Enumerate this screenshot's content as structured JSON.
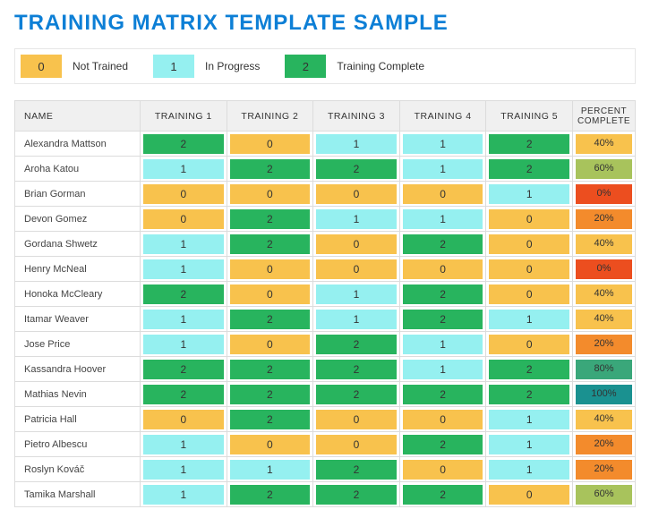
{
  "title": "TRAINING MATRIX TEMPLATE SAMPLE",
  "legend": [
    {
      "code": "0",
      "label": "Not Trained",
      "swatch": "c-orange"
    },
    {
      "code": "1",
      "label": "In Progress",
      "swatch": "c-cyan"
    },
    {
      "code": "2",
      "label": "Training Complete",
      "swatch": "c-green"
    }
  ],
  "columns": {
    "name": "NAME",
    "trainings": [
      "TRAINING 1",
      "TRAINING 2",
      "TRAINING 3",
      "TRAINING 4",
      "TRAINING 5"
    ],
    "percent": "PERCENT COMPLETE"
  },
  "rows": [
    {
      "name": "Alexandra Mattson",
      "v": [
        2,
        0,
        1,
        1,
        2
      ],
      "pct": "40%"
    },
    {
      "name": "Aroha Katou",
      "v": [
        1,
        2,
        2,
        1,
        2
      ],
      "pct": "60%"
    },
    {
      "name": "Brian Gorman",
      "v": [
        0,
        0,
        0,
        0,
        1
      ],
      "pct": "0%"
    },
    {
      "name": "Devon Gomez",
      "v": [
        0,
        2,
        1,
        1,
        0
      ],
      "pct": "20%"
    },
    {
      "name": "Gordana Shwetz",
      "v": [
        1,
        2,
        0,
        2,
        0
      ],
      "pct": "40%"
    },
    {
      "name": "Henry McNeal",
      "v": [
        1,
        0,
        0,
        0,
        0
      ],
      "pct": "0%"
    },
    {
      "name": "Honoka McCleary",
      "v": [
        2,
        0,
        1,
        2,
        0
      ],
      "pct": "40%"
    },
    {
      "name": "Itamar Weaver",
      "v": [
        1,
        2,
        1,
        2,
        1
      ],
      "pct": "40%"
    },
    {
      "name": "Jose Price",
      "v": [
        1,
        0,
        2,
        1,
        0
      ],
      "pct": "20%"
    },
    {
      "name": "Kassandra Hoover",
      "v": [
        2,
        2,
        2,
        1,
        2
      ],
      "pct": "80%"
    },
    {
      "name": "Mathias Nevin",
      "v": [
        2,
        2,
        2,
        2,
        2
      ],
      "pct": "100%"
    },
    {
      "name": "Patricia Hall",
      "v": [
        0,
        2,
        0,
        0,
        1
      ],
      "pct": "40%"
    },
    {
      "name": "Pietro Albescu",
      "v": [
        1,
        0,
        0,
        2,
        1
      ],
      "pct": "20%"
    },
    {
      "name": "Roslyn Kováč",
      "v": [
        1,
        1,
        2,
        0,
        1
      ],
      "pct": "20%"
    },
    {
      "name": "Tamika Marshall",
      "v": [
        1,
        2,
        2,
        2,
        0
      ],
      "pct": "60%"
    }
  ],
  "chart_data": {
    "type": "table",
    "title": "Training Matrix",
    "value_meaning": {
      "0": "Not Trained",
      "1": "In Progress",
      "2": "Training Complete"
    },
    "columns": [
      "TRAINING 1",
      "TRAINING 2",
      "TRAINING 3",
      "TRAINING 4",
      "TRAINING 5"
    ],
    "names": [
      "Alexandra Mattson",
      "Aroha Katou",
      "Brian Gorman",
      "Devon Gomez",
      "Gordana Shwetz",
      "Henry McNeal",
      "Honoka McCleary",
      "Itamar Weaver",
      "Jose Price",
      "Kassandra Hoover",
      "Mathias Nevin",
      "Patricia Hall",
      "Pietro Albescu",
      "Roslyn Kováč",
      "Tamika Marshall"
    ],
    "matrix": [
      [
        2,
        0,
        1,
        1,
        2
      ],
      [
        1,
        2,
        2,
        1,
        2
      ],
      [
        0,
        0,
        0,
        0,
        1
      ],
      [
        0,
        2,
        1,
        1,
        0
      ],
      [
        1,
        2,
        0,
        2,
        0
      ],
      [
        1,
        0,
        0,
        0,
        0
      ],
      [
        2,
        0,
        1,
        2,
        0
      ],
      [
        1,
        2,
        1,
        2,
        1
      ],
      [
        1,
        0,
        2,
        1,
        0
      ],
      [
        2,
        2,
        2,
        1,
        2
      ],
      [
        2,
        2,
        2,
        2,
        2
      ],
      [
        0,
        2,
        0,
        0,
        1
      ],
      [
        1,
        0,
        0,
        2,
        1
      ],
      [
        1,
        1,
        2,
        0,
        1
      ],
      [
        1,
        2,
        2,
        2,
        0
      ]
    ],
    "percent_complete": [
      40,
      60,
      0,
      20,
      40,
      0,
      40,
      40,
      20,
      80,
      100,
      40,
      20,
      20,
      60
    ]
  }
}
